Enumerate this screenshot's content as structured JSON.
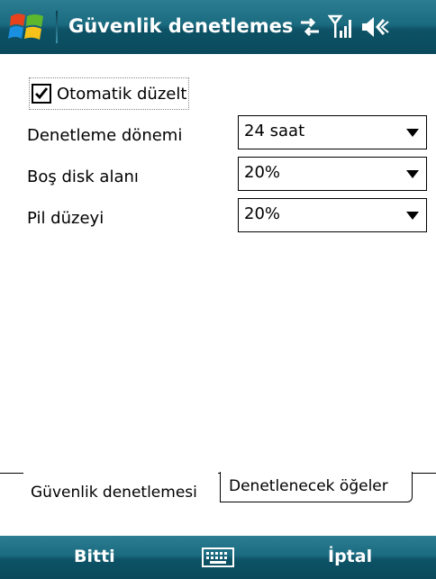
{
  "titlebar": {
    "title": "Güvenlik denetlemes",
    "start_icon": "windows-flag-icon",
    "tray_icons": [
      "connectivity-icon",
      "signal-strength-icon",
      "volume-icon"
    ]
  },
  "form": {
    "auto_fix": {
      "label": "Otomatik düzelt",
      "checked": true
    },
    "rows": [
      {
        "label": "Denetleme dönemi",
        "value": "24 saat"
      },
      {
        "label": "Boş disk alanı",
        "value": "20%"
      },
      {
        "label": "Pil düzeyi",
        "value": "20%"
      }
    ]
  },
  "tabs": [
    {
      "label": "Güvenlik denetlemesi",
      "active": true
    },
    {
      "label": "Denetlenecek öğeler",
      "active": false
    }
  ],
  "softkeys": {
    "left": "Bitti",
    "center_icon": "keyboard-icon",
    "right": "İptal"
  },
  "colors": {
    "bar_top": "#2c7d92",
    "bar_bottom": "#0b4a5d",
    "text_on_bar": "#ffffff"
  }
}
